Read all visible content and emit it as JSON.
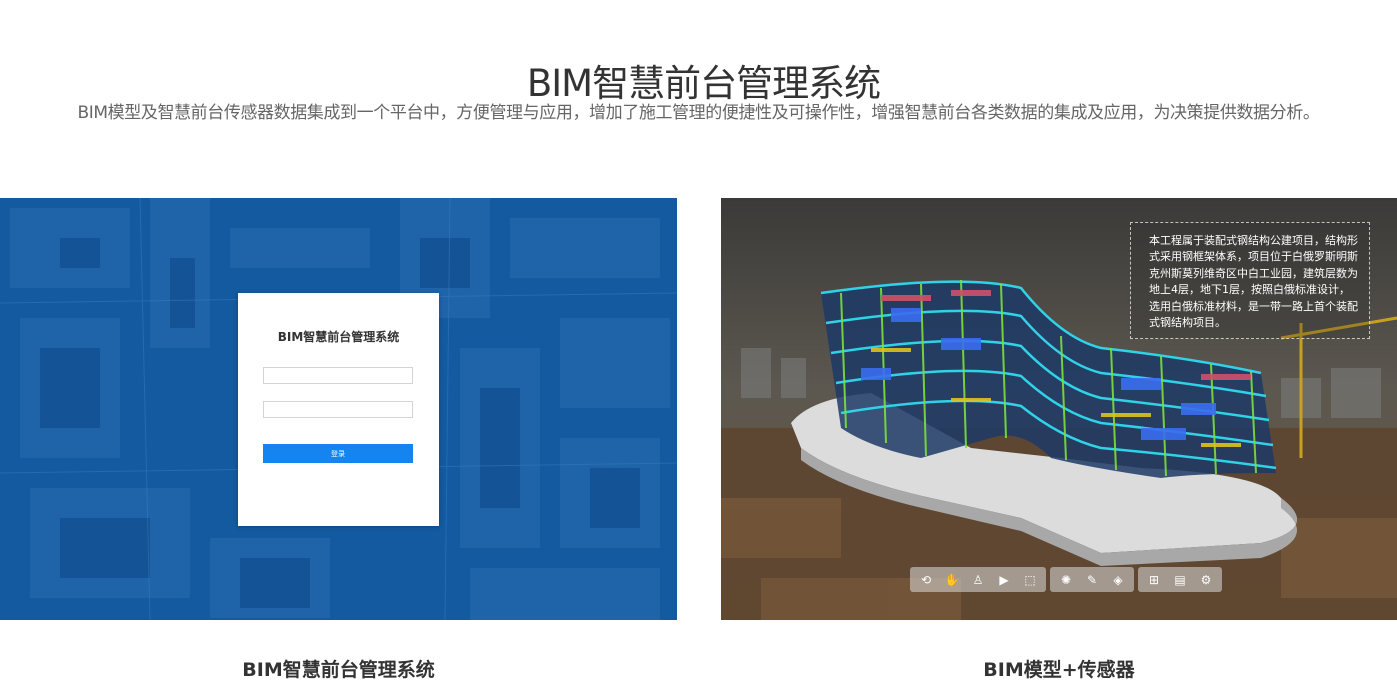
{
  "header": {
    "title": "BIM智慧前台管理系统",
    "subtitle": "BIM模型及智慧前台传感器数据集成到一个平台中，方便管理与应用，增加了施工管理的便捷性及可操作性，增强智慧前台各类数据的集成及应用，为决策提供数据分析。"
  },
  "left_card": {
    "login_title": "BIM智慧前台管理系统",
    "username_value": "",
    "password_value": "",
    "login_button": "登录",
    "caption": "BIM智慧前台管理系统"
  },
  "right_card": {
    "info_text": "本工程属于装配式钢结构公建项目，结构形式采用钢框架体系，项目位于白俄罗斯明斯克州斯莫列维奇区中白工业园，建筑层数为地上4层，地下1层，按照白俄标准设计，选用白俄标准材料，是一带一路上首个装配式钢结构项目。",
    "caption": "BIM模型+传感器",
    "toolbar_icons": [
      [
        "orbit-icon",
        "pan-hand-icon",
        "walk-person-icon",
        "camera-icon",
        "zoom-box-icon"
      ],
      [
        "explode-icon",
        "measure-pencil-icon",
        "section-cube-icon"
      ],
      [
        "tree-structure-icon",
        "properties-doc-icon",
        "settings-gear-icon"
      ]
    ]
  },
  "colors": {
    "login_panel_bg": "#135aa0",
    "login_button": "#1684ee",
    "title_text": "#333333",
    "subtitle_text": "#666666"
  }
}
